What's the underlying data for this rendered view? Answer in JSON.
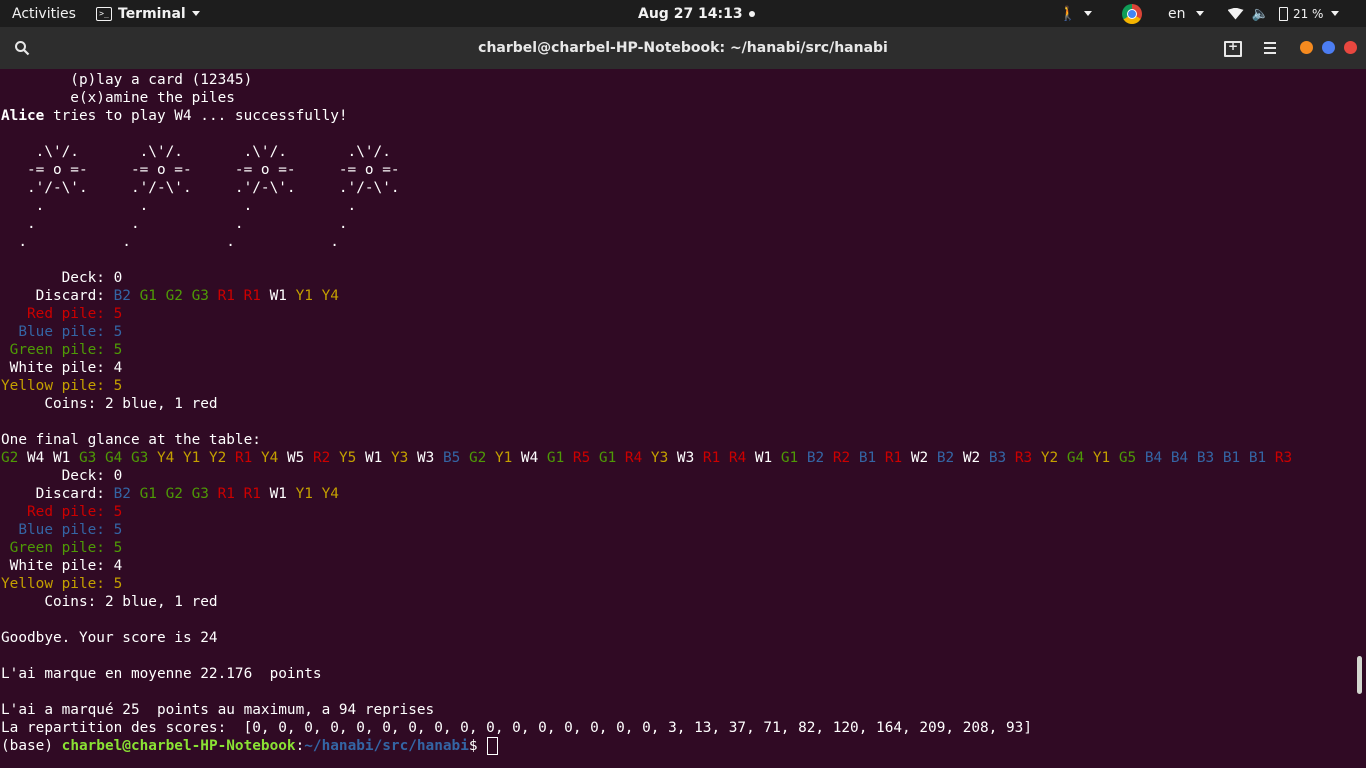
{
  "topbar": {
    "activities": "Activities",
    "app": "Terminal",
    "clock": "Aug 27  14:13",
    "lang": "en",
    "battery": "21 %"
  },
  "window": {
    "title": "charbel@charbel-HP-Notebook: ~/hanabi/src/hanabi"
  },
  "terminal": {
    "lines": [
      [
        {
          "t": "        (p)lay a card (12345)"
        }
      ],
      [
        {
          "t": "        e(x)amine the piles"
        }
      ],
      [
        {
          "t": "Alice",
          "c": "b"
        },
        {
          "t": " tries to play W4 ... successfully!"
        }
      ],
      [
        {
          "t": ""
        }
      ],
      [
        {
          "t": "    .\\'/.       .\\'/.       .\\'/.       .\\'/."
        }
      ],
      [
        {
          "t": "   -= o =-     -= o =-     -= o =-     -= o =-"
        }
      ],
      [
        {
          "t": "   .'/-\\'.     .'/-\\'.     .'/-\\'.     .'/-\\'."
        }
      ],
      [
        {
          "t": "    .           .           .           ."
        }
      ],
      [
        {
          "t": "   .           .           .           ."
        }
      ],
      [
        {
          "t": "  .           .           .           ."
        }
      ],
      [
        {
          "t": ""
        }
      ],
      [
        {
          "t": "       Deck: 0"
        }
      ],
      [
        {
          "t": "    Discard: "
        },
        {
          "t": "B2",
          "c": "B"
        },
        {
          "t": " "
        },
        {
          "t": "G1",
          "c": "G"
        },
        {
          "t": " "
        },
        {
          "t": "G2",
          "c": "G"
        },
        {
          "t": " "
        },
        {
          "t": "G3",
          "c": "G"
        },
        {
          "t": " "
        },
        {
          "t": "R1",
          "c": "R"
        },
        {
          "t": " "
        },
        {
          "t": "R1",
          "c": "R"
        },
        {
          "t": " W1 "
        },
        {
          "t": "Y1",
          "c": "Y"
        },
        {
          "t": " "
        },
        {
          "t": "Y4",
          "c": "Y"
        }
      ],
      [
        {
          "t": "   Red pile: 5",
          "c": "R"
        }
      ],
      [
        {
          "t": "  Blue pile: 5",
          "c": "B"
        }
      ],
      [
        {
          "t": " Green pile: 5",
          "c": "G"
        }
      ],
      [
        {
          "t": " White pile: 4"
        }
      ],
      [
        {
          "t": "Yellow pile: 5",
          "c": "Y"
        }
      ],
      [
        {
          "t": "     Coins: 2 blue, 1 red"
        }
      ],
      [
        {
          "t": ""
        }
      ],
      [
        {
          "t": "One final glance at the table:"
        }
      ],
      [
        {
          "t": "G2",
          "c": "G"
        },
        {
          "t": " W4 W1 "
        },
        {
          "t": "G3",
          "c": "G"
        },
        {
          "t": " "
        },
        {
          "t": "G4",
          "c": "G"
        },
        {
          "t": " "
        },
        {
          "t": "G3",
          "c": "G"
        },
        {
          "t": " "
        },
        {
          "t": "Y4",
          "c": "Y"
        },
        {
          "t": " "
        },
        {
          "t": "Y1",
          "c": "Y"
        },
        {
          "t": " "
        },
        {
          "t": "Y2",
          "c": "Y"
        },
        {
          "t": " "
        },
        {
          "t": "R1",
          "c": "R"
        },
        {
          "t": " "
        },
        {
          "t": "Y4",
          "c": "Y"
        },
        {
          "t": " W5 "
        },
        {
          "t": "R2",
          "c": "R"
        },
        {
          "t": " "
        },
        {
          "t": "Y5",
          "c": "Y"
        },
        {
          "t": " W1 "
        },
        {
          "t": "Y3",
          "c": "Y"
        },
        {
          "t": " W3 "
        },
        {
          "t": "B5",
          "c": "B"
        },
        {
          "t": " "
        },
        {
          "t": "G2",
          "c": "G"
        },
        {
          "t": " "
        },
        {
          "t": "Y1",
          "c": "Y"
        },
        {
          "t": " W4 "
        },
        {
          "t": "G1",
          "c": "G"
        },
        {
          "t": " "
        },
        {
          "t": "R5",
          "c": "R"
        },
        {
          "t": " "
        },
        {
          "t": "G1",
          "c": "G"
        },
        {
          "t": " "
        },
        {
          "t": "R4",
          "c": "R"
        },
        {
          "t": " "
        },
        {
          "t": "Y3",
          "c": "Y"
        },
        {
          "t": " W3 "
        },
        {
          "t": "R1",
          "c": "R"
        },
        {
          "t": " "
        },
        {
          "t": "R4",
          "c": "R"
        },
        {
          "t": " W1 "
        },
        {
          "t": "G1",
          "c": "G"
        },
        {
          "t": " "
        },
        {
          "t": "B2",
          "c": "B"
        },
        {
          "t": " "
        },
        {
          "t": "R2",
          "c": "R"
        },
        {
          "t": " "
        },
        {
          "t": "B1",
          "c": "B"
        },
        {
          "t": " "
        },
        {
          "t": "R1",
          "c": "R"
        },
        {
          "t": " W2 "
        },
        {
          "t": "B2",
          "c": "B"
        },
        {
          "t": " W2 "
        },
        {
          "t": "B3",
          "c": "B"
        },
        {
          "t": " "
        },
        {
          "t": "R3",
          "c": "R"
        },
        {
          "t": " "
        },
        {
          "t": "Y2",
          "c": "Y"
        },
        {
          "t": " "
        },
        {
          "t": "G4",
          "c": "G"
        },
        {
          "t": " "
        },
        {
          "t": "Y1",
          "c": "Y"
        },
        {
          "t": " "
        },
        {
          "t": "G5",
          "c": "G"
        },
        {
          "t": " "
        },
        {
          "t": "B4",
          "c": "B"
        },
        {
          "t": " "
        },
        {
          "t": "B4",
          "c": "B"
        },
        {
          "t": " "
        },
        {
          "t": "B3",
          "c": "B"
        },
        {
          "t": " "
        },
        {
          "t": "B1",
          "c": "B"
        },
        {
          "t": " "
        },
        {
          "t": "B1",
          "c": "B"
        },
        {
          "t": " "
        },
        {
          "t": "R3",
          "c": "R"
        }
      ],
      [
        {
          "t": "       Deck: 0"
        }
      ],
      [
        {
          "t": "    Discard: "
        },
        {
          "t": "B2",
          "c": "B"
        },
        {
          "t": " "
        },
        {
          "t": "G1",
          "c": "G"
        },
        {
          "t": " "
        },
        {
          "t": "G2",
          "c": "G"
        },
        {
          "t": " "
        },
        {
          "t": "G3",
          "c": "G"
        },
        {
          "t": " "
        },
        {
          "t": "R1",
          "c": "R"
        },
        {
          "t": " "
        },
        {
          "t": "R1",
          "c": "R"
        },
        {
          "t": " W1 "
        },
        {
          "t": "Y1",
          "c": "Y"
        },
        {
          "t": " "
        },
        {
          "t": "Y4",
          "c": "Y"
        }
      ],
      [
        {
          "t": "   Red pile: 5",
          "c": "R"
        }
      ],
      [
        {
          "t": "  Blue pile: 5",
          "c": "B"
        }
      ],
      [
        {
          "t": " Green pile: 5",
          "c": "G"
        }
      ],
      [
        {
          "t": " White pile: 4"
        }
      ],
      [
        {
          "t": "Yellow pile: 5",
          "c": "Y"
        }
      ],
      [
        {
          "t": "     Coins: 2 blue, 1 red"
        }
      ],
      [
        {
          "t": ""
        }
      ],
      [
        {
          "t": "Goodbye. Your score is 24"
        }
      ],
      [
        {
          "t": ""
        }
      ],
      [
        {
          "t": "L'ai marque en moyenne 22.176  points"
        }
      ],
      [
        {
          "t": ""
        }
      ],
      [
        {
          "t": "L'ai a marqué 25  points au maximum, a 94 reprises"
        }
      ],
      [
        {
          "t": "La repartition des scores:  [0, 0, 0, 0, 0, 0, 0, 0, 0, 0, 0, 0, 0, 0, 0, 0, 3, 13, 37, 71, 82, 120, 164, 209, 208, 93]"
        }
      ]
    ],
    "prompt": {
      "env": "(base) ",
      "user_host": "charbel@charbel-HP-Notebook",
      "sep": ":",
      "path": "~/hanabi/src/hanabi",
      "dollar": "$ "
    }
  }
}
